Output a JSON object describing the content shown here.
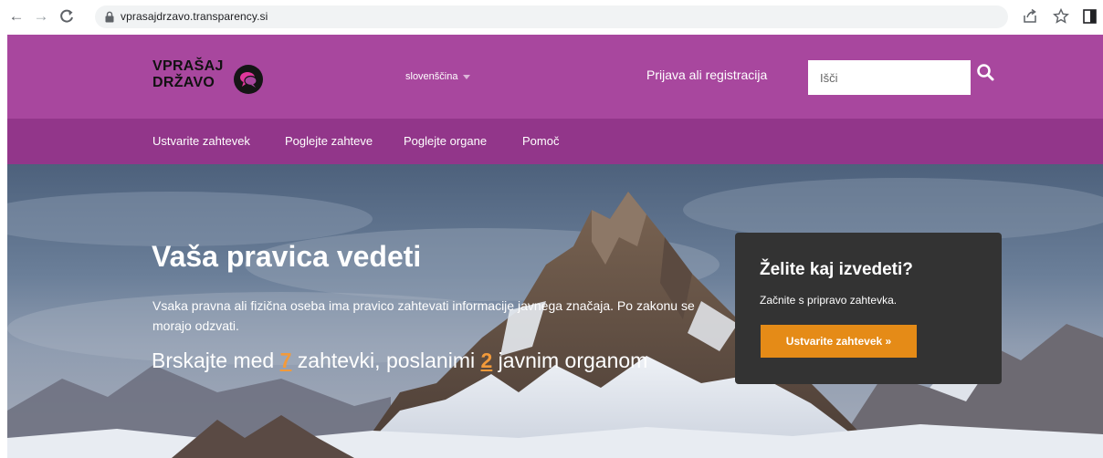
{
  "browser": {
    "url": "vprasajdrzavo.transparency.si"
  },
  "header": {
    "logo_line1": "VPRAŠAJ",
    "logo_line2": "DRŽAVO",
    "language": "slovenščina",
    "login": "Prijava ali registracija",
    "search_placeholder": "Išči"
  },
  "nav": {
    "items": [
      {
        "label": "Ustvarite zahtevek"
      },
      {
        "label": "Poglejte zahteve"
      },
      {
        "label": "Poglejte organe"
      },
      {
        "label": "Pomoč"
      }
    ]
  },
  "hero": {
    "title": "Vaša pravica vedeti",
    "text": "Vsaka pravna ali fizična oseba ima pravico zahtevati informacije javnega značaja. Po zakonu se morajo odzvati.",
    "browse_prefix": "Brskajte med ",
    "requests_count": "7",
    "browse_middle": " zahtevki, poslanimi ",
    "bodies_count": "2",
    "browse_suffix": " javnim organom"
  },
  "cta": {
    "title": "Želite kaj izvedeti?",
    "subtitle": "Začnite s pripravo zahtevka.",
    "button": "Ustvarite zahtevek »"
  },
  "colors": {
    "header_bg": "#a8479e",
    "nav_bg": "#92368a",
    "accent": "#e58b17",
    "cta_bg": "#333333"
  }
}
